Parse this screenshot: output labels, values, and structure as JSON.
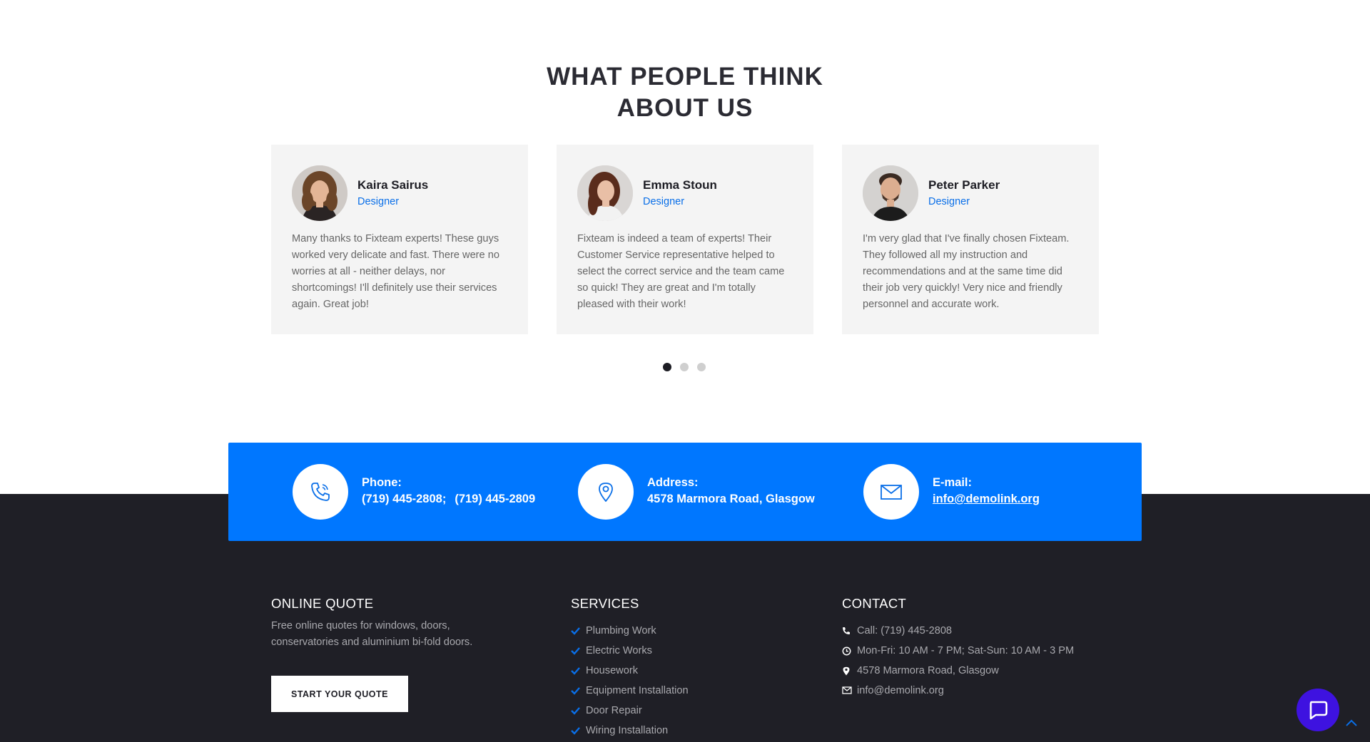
{
  "testimonials": {
    "title_line1": "WHAT PEOPLE THINK",
    "title_line2": "ABOUT US",
    "items": [
      {
        "name": "Kaira Sairus",
        "role": "Designer",
        "quote": "Many thanks to Fixteam experts! These guys worked very delicate and fast. There were no worries at all - neither delays, nor shortcomings! I'll definitely use their services again. Great job!",
        "avatar": "woman-curly-hair-avatar"
      },
      {
        "name": "Emma Stoun",
        "role": "Designer",
        "quote": "Fixteam is indeed a team of experts! Their Customer Service representative helped to select the correct service and the team came so quick! They are great and I'm totally pleased with their work!",
        "avatar": "woman-long-hair-avatar"
      },
      {
        "name": "Peter Parker",
        "role": "Designer",
        "quote": "I'm very glad that I've finally chosen Fixteam. They followed all my instruction and recommendations and at the same time did their job very quickly! Very nice and friendly personnel and accurate work.",
        "avatar": "man-beard-avatar"
      }
    ],
    "pagination": {
      "count": 3,
      "active": 1
    }
  },
  "contact_band": {
    "phone": {
      "label": "Phone:",
      "value1": "(719) 445-2808;",
      "value2": "(719) 445-2809",
      "icon": "phone-icon"
    },
    "address": {
      "label": "Address:",
      "value": "4578 Marmora Road, Glasgow",
      "icon": "map-pin-icon"
    },
    "email": {
      "label": "E-mail:",
      "value": "info@demolink.org",
      "icon": "envelope-icon"
    }
  },
  "footer": {
    "online_quote": {
      "title": "ONLINE QUOTE",
      "description": "Free online quotes for windows, doors, conservatories and aluminium bi-fold doors.",
      "button_label": "START YOUR QUOTE"
    },
    "services": {
      "title": "SERVICES",
      "items": [
        "Plumbing Work",
        "Electric Works",
        "Housework",
        "Equipment Installation",
        "Door Repair",
        "Wiring Installation"
      ]
    },
    "contact": {
      "title": "CONTACT",
      "call": "Call: (719) 445-2808",
      "hours": "Mon-Fri: 10 AM - 7 PM; Sat-Sun: 10 AM - 3 PM",
      "address": "4578 Marmora Road, Glasgow",
      "email": "info@demolink.org"
    }
  },
  "colors": {
    "accent": "#0077ff",
    "role_text": "#0a6fe8",
    "footer_bg": "#1f1f26",
    "card_bg": "#f4f4f4",
    "chat_widget": "#3e12e0"
  }
}
